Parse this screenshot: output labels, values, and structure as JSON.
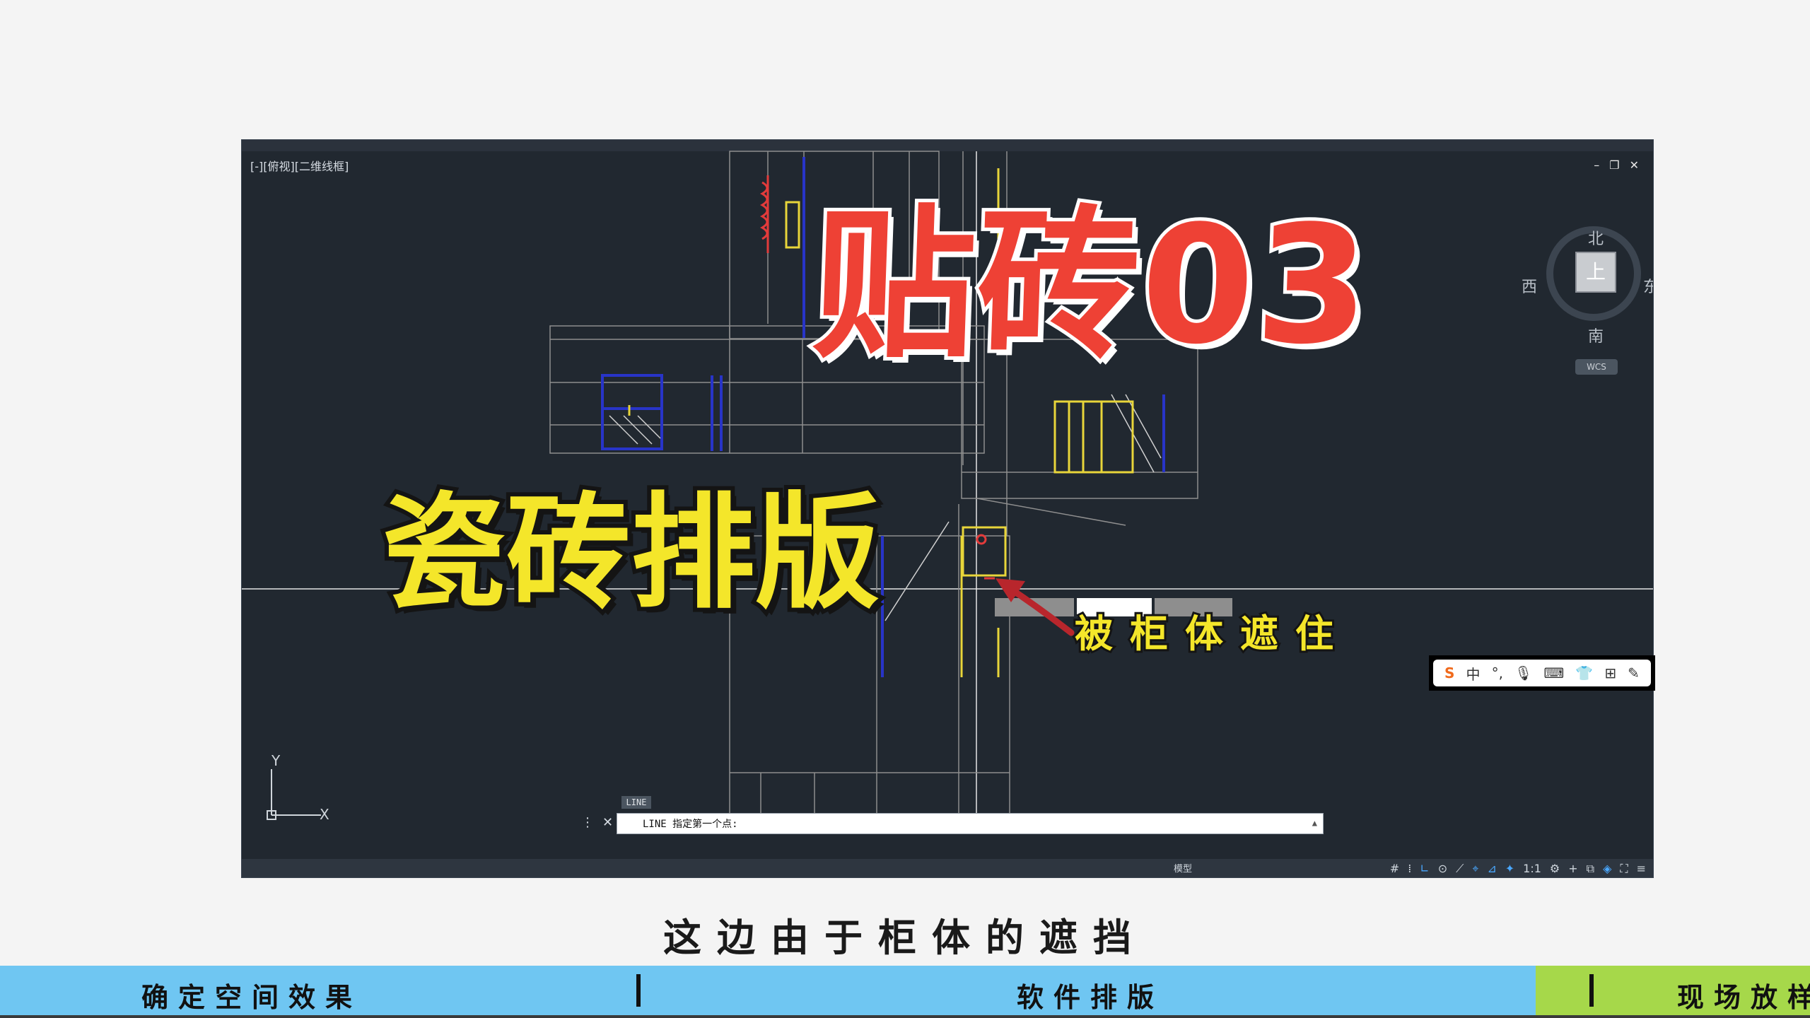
{
  "viewport": {
    "label": "[-][俯视][二维线框]",
    "controls": [
      "–",
      "❐",
      "✕"
    ]
  },
  "viewcube": {
    "face": "上",
    "north": "北",
    "south": "南",
    "west": "西",
    "east": "东",
    "wcs": "WCS"
  },
  "ucs": {
    "y": "Y",
    "x": "X"
  },
  "command": {
    "tag": "LINE",
    "prompt": "LINE 指定第一个点:"
  },
  "statusbar": {
    "model": "模型"
  },
  "ime": {
    "items": [
      "S",
      "中",
      "°,",
      "🎙",
      "⌨",
      "👕",
      "⊞",
      "✎"
    ]
  },
  "overlay": {
    "title": "贴砖03",
    "subtitle": "瓷砖排版",
    "annotation": "被柜体遮住"
  },
  "caption": "这边由于柜体的遮挡",
  "progress": {
    "segments": [
      "确定空间效果",
      "软件排版",
      "现场放样"
    ],
    "colors": {
      "done": "#6fc6f2",
      "current": "#a6d84a"
    }
  }
}
